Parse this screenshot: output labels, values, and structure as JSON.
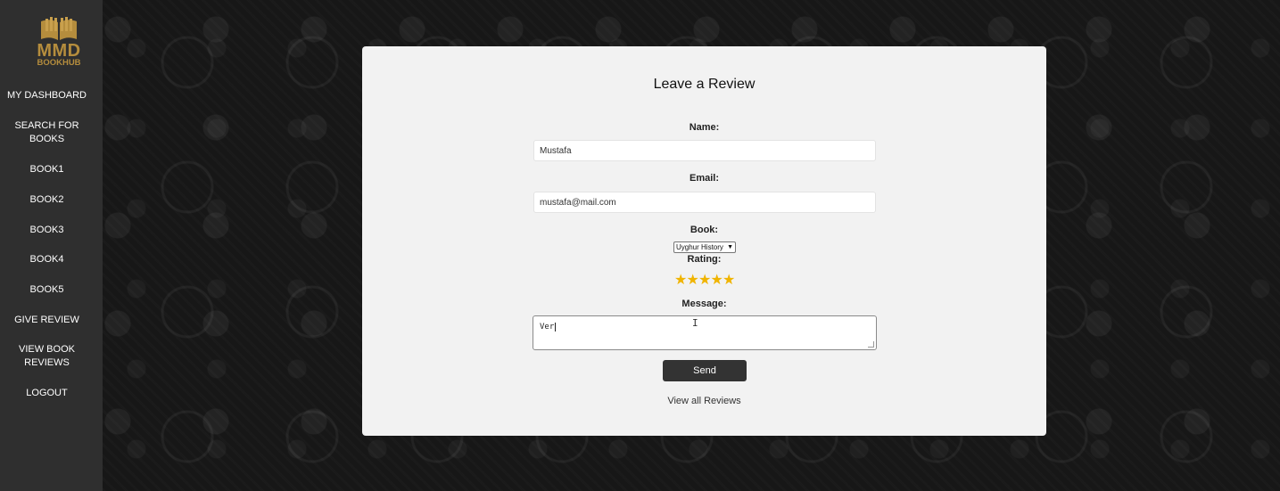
{
  "sidebar": {
    "logo": {
      "title": "MMD",
      "subtitle": "BOOKHUB"
    },
    "items": [
      {
        "label": "MY DASHBOARD"
      },
      {
        "label": "SEARCH FOR BOOKS"
      },
      {
        "label": "BOOK1"
      },
      {
        "label": "BOOK2"
      },
      {
        "label": "BOOK3"
      },
      {
        "label": "BOOK4"
      },
      {
        "label": "BOOK5"
      },
      {
        "label": "GIVE REVIEW"
      },
      {
        "label": "VIEW BOOK REVIEWS"
      },
      {
        "label": "LOGOUT"
      }
    ]
  },
  "form": {
    "title": "Leave a Review",
    "name_label": "Name:",
    "name_value": "Mustafa",
    "email_label": "Email:",
    "email_value": "mustafa@mail.com",
    "book_label": "Book:",
    "book_selected": "Uyghur History",
    "rating_label": "Rating:",
    "rating": {
      "value": 5,
      "max": 5,
      "star": "★",
      "color": "#f0b400"
    },
    "message_label": "Message:",
    "message_value": "Ver",
    "send_label": "Send",
    "view_all_label": "View all Reviews"
  },
  "colors": {
    "sidebar_bg": "#2f2f2f",
    "logo_gold": "#b58d3d",
    "card_bg": "#f2f2f2",
    "button_bg": "#333333"
  }
}
